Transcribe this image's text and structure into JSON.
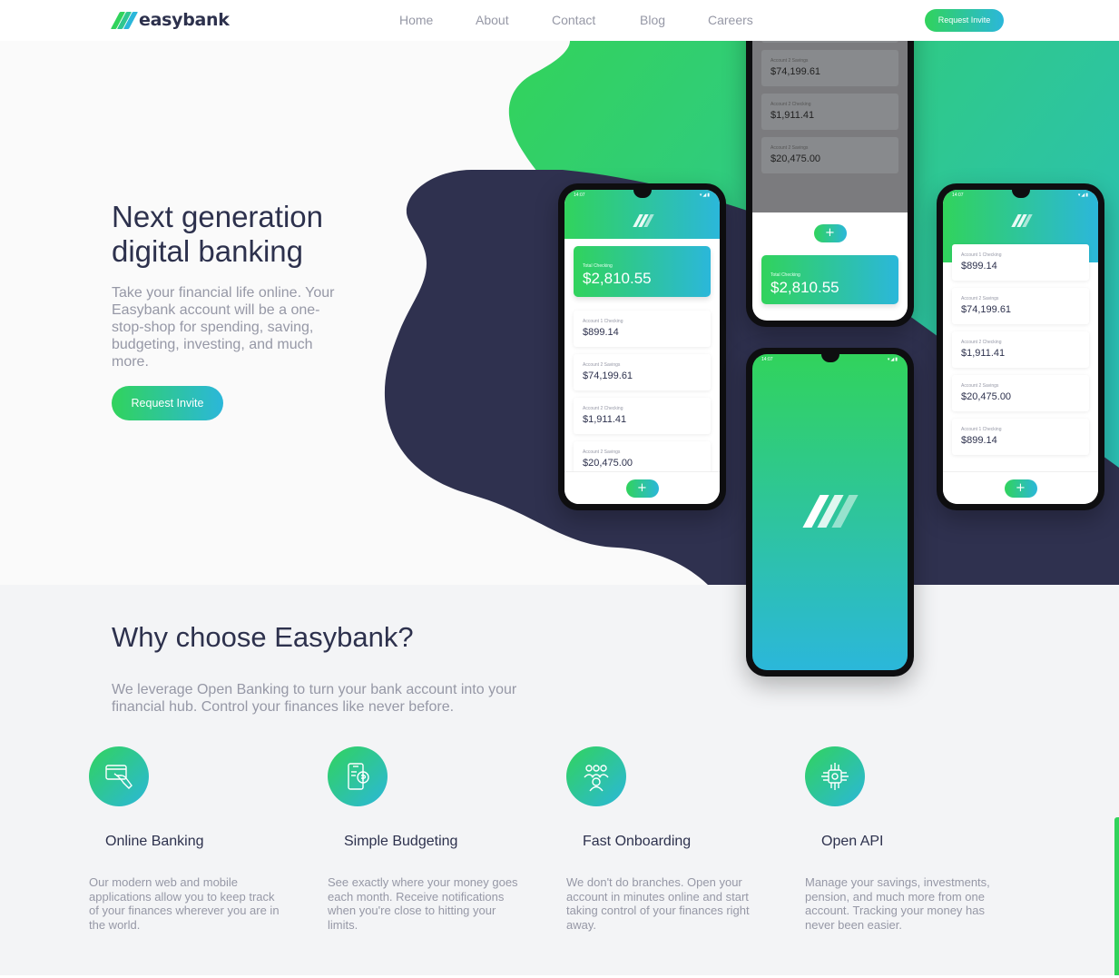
{
  "brand": {
    "name": "easybank",
    "green": "#31d35c",
    "cyan": "#2bb7da",
    "navy": "#2d314d",
    "gray": "#9698a6"
  },
  "nav": {
    "links": [
      "Home",
      "About",
      "Contact",
      "Blog",
      "Careers"
    ],
    "cta": "Request Invite"
  },
  "hero": {
    "title_line1": "Next generation",
    "title_line2": "digital banking",
    "text": "Take your financial life online. Your Easybank account will be a one-stop-shop for spending, saving, budgeting, investing, and much more.",
    "cta": "Request Invite"
  },
  "phones": {
    "status_time": "14:07",
    "total_label": "Total Checking",
    "total_value": "$2,810.55",
    "fab": "+",
    "accounts": [
      {
        "label": "Account 1 Checking",
        "value": "$899.14"
      },
      {
        "label": "Account 2 Savings",
        "value": "$74,199.61"
      },
      {
        "label": "Account 2 Checking",
        "value": "$1,911.41"
      },
      {
        "label": "Account 2 Savings",
        "value": "$20,475.00"
      },
      {
        "label": "Account 1 Checking",
        "value": "$899.14"
      }
    ]
  },
  "why": {
    "title": "Why choose Easybank?",
    "text": "We leverage Open Banking to turn your bank account into your financial hub. Control your finances like never before.",
    "features": [
      {
        "title": "Online Banking",
        "icon": "online-banking-icon",
        "text": "Our modern web and mobile applications allow you to keep track of your finances wherever you are in the world."
      },
      {
        "title": "Simple Budgeting",
        "icon": "budgeting-icon",
        "text": "See exactly where your money goes each month. Receive notifications when you're close to hitting your limits."
      },
      {
        "title": "Fast Onboarding",
        "icon": "onboarding-icon",
        "text": "We don't do branches. Open your account in minutes online and start taking control of your finances right away."
      },
      {
        "title": "Open API",
        "icon": "api-icon",
        "text": "Manage your savings, investments, pension, and much more from one account. Tracking your money has never been easier."
      }
    ]
  }
}
